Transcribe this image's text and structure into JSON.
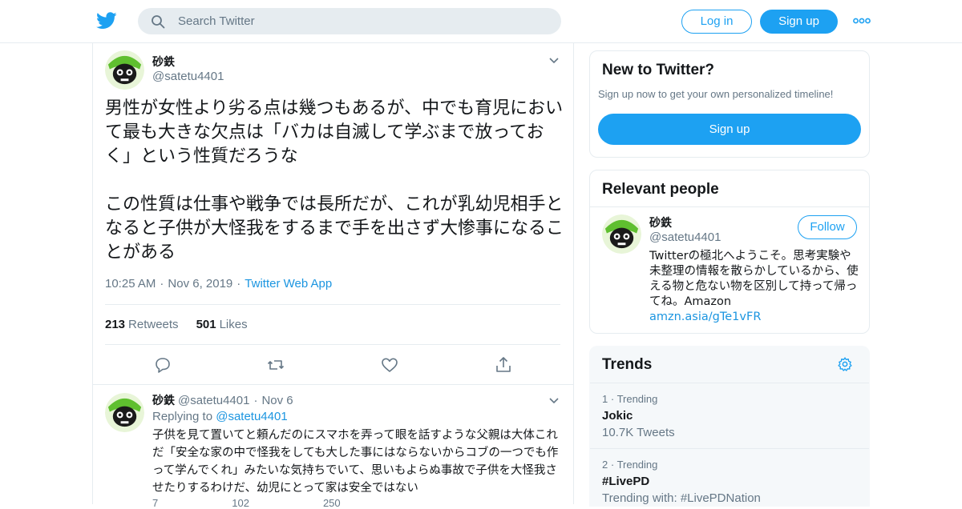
{
  "header": {
    "search_placeholder": "Search Twitter",
    "login_label": "Log in",
    "signup_label": "Sign up"
  },
  "tweet": {
    "author_name": "砂鉄",
    "author_handle": "@satetu4401",
    "text": "男性が女性より劣る点は幾つもあるが、中でも育児において最も大きな欠点は「バカは自滅して学ぶまで放っておく」という性質だろうな\n\nこの性質は仕事や戦争では長所だが、これが乳幼児相手となると子供が大怪我をするまで手を出さず大惨事になることがある",
    "time": "10:25 AM",
    "date": "Nov 6, 2019",
    "source": "Twitter Web App",
    "retweets_count": "213",
    "retweets_label": "Retweets",
    "likes_count": "501",
    "likes_label": "Likes"
  },
  "reply": {
    "author_name": "砂鉄",
    "author_handle": "@satetu4401",
    "date": "Nov 6",
    "replying_prefix": "Replying to",
    "replying_handle": "@satetu4401",
    "text": "子供を見て置いてと頼んだのにスマホを弄って眼を話すような父親は大体これだ「安全な家の中で怪我をしても大した事にはならないからコブの一つでも作って学んでくれ」みたいな気持ちでいて、思いもよらぬ事故で子供を大怪我させたりするわけだ、幼児にとって家は安全ではない",
    "reply_count": "7",
    "retweet_count": "102",
    "like_count": "250"
  },
  "sidebar": {
    "new_title": "New to Twitter?",
    "new_subtitle": "Sign up now to get your own personalized timeline!",
    "new_signup_label": "Sign up",
    "people_title": "Relevant people",
    "person_name": "砂鉄",
    "person_handle": "@satetu4401",
    "follow_label": "Follow",
    "bio": "Twitterの極北へようこそ。思考実験や未整理の情報を散らかしているから、使える物と危ない物を区別して持って帰ってね。Amazon",
    "bio_link": "amzn.asia/gTe1vFR",
    "trends_title": "Trends",
    "trends": [
      {
        "rank": "1",
        "label": "Trending",
        "name": "Jokic",
        "sub": "10.7K Tweets"
      },
      {
        "rank": "2",
        "label": "Trending",
        "name": "#LivePD",
        "sub": "Trending with: #LivePDNation"
      }
    ]
  },
  "colors": {
    "brand": "#1da1f2",
    "link": "#1b95e0",
    "muted_text": "#657786",
    "border": "#e6ecf0",
    "search_bg": "#e6ecf0",
    "trends_bg": "#f5f8fa"
  },
  "icons": [
    "twitter-bird-icon",
    "search-icon",
    "more-icon",
    "chevron-down-icon",
    "reply-icon",
    "retweet-icon",
    "like-icon",
    "share-icon",
    "settings-gear-icon"
  ]
}
